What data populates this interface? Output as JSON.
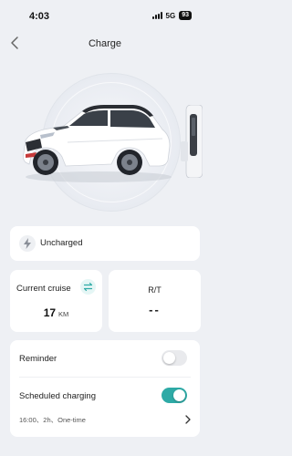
{
  "status_bar": {
    "time": "4:03",
    "network": "5G",
    "battery": "93"
  },
  "nav": {
    "title": "Charge",
    "back_icon": "chevron-left-icon"
  },
  "hero": {
    "vehicle": "white-suv-image",
    "charger": "charging-station-image"
  },
  "charge_status": {
    "icon": "lightning-icon",
    "label": "Uncharged"
  },
  "cruise": {
    "label": "Current cruise",
    "swap_icon": "swap-icon",
    "value": "17",
    "unit": "KM"
  },
  "rt": {
    "label": "R/T",
    "value": "--"
  },
  "settings": {
    "reminder": {
      "label": "Reminder",
      "enabled": false
    },
    "scheduled": {
      "label": "Scheduled charging",
      "enabled": true,
      "detail": "16:00、2h、One-time"
    }
  },
  "colors": {
    "accent": "#2eaaa6",
    "background": "#eef0f4"
  }
}
